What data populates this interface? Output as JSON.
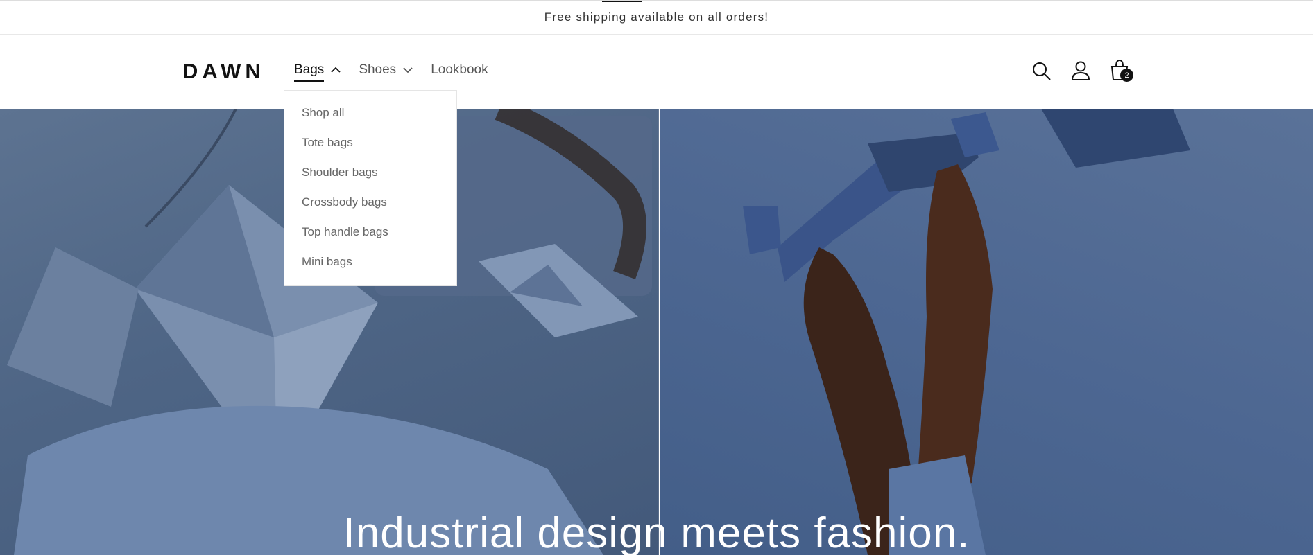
{
  "announcement": {
    "text": "Free shipping available on all orders!"
  },
  "header": {
    "logo": "DAWN",
    "nav": [
      {
        "label": "Bags",
        "expanded": true
      },
      {
        "label": "Shoes",
        "expanded": false
      },
      {
        "label": "Lookbook"
      }
    ],
    "cart_count": "2",
    "icons": [
      "search-icon",
      "account-icon",
      "cart-icon"
    ]
  },
  "dropdown": {
    "items": [
      "Shop all",
      "Tote bags",
      "Shoulder bags",
      "Crossbody bags",
      "Top handle bags",
      "Mini bags"
    ]
  },
  "hero": {
    "title": "Industrial design meets fashion."
  },
  "colors": {
    "text": "#121212",
    "hero_left": "#4e6585",
    "hero_right": "#4d6792"
  }
}
